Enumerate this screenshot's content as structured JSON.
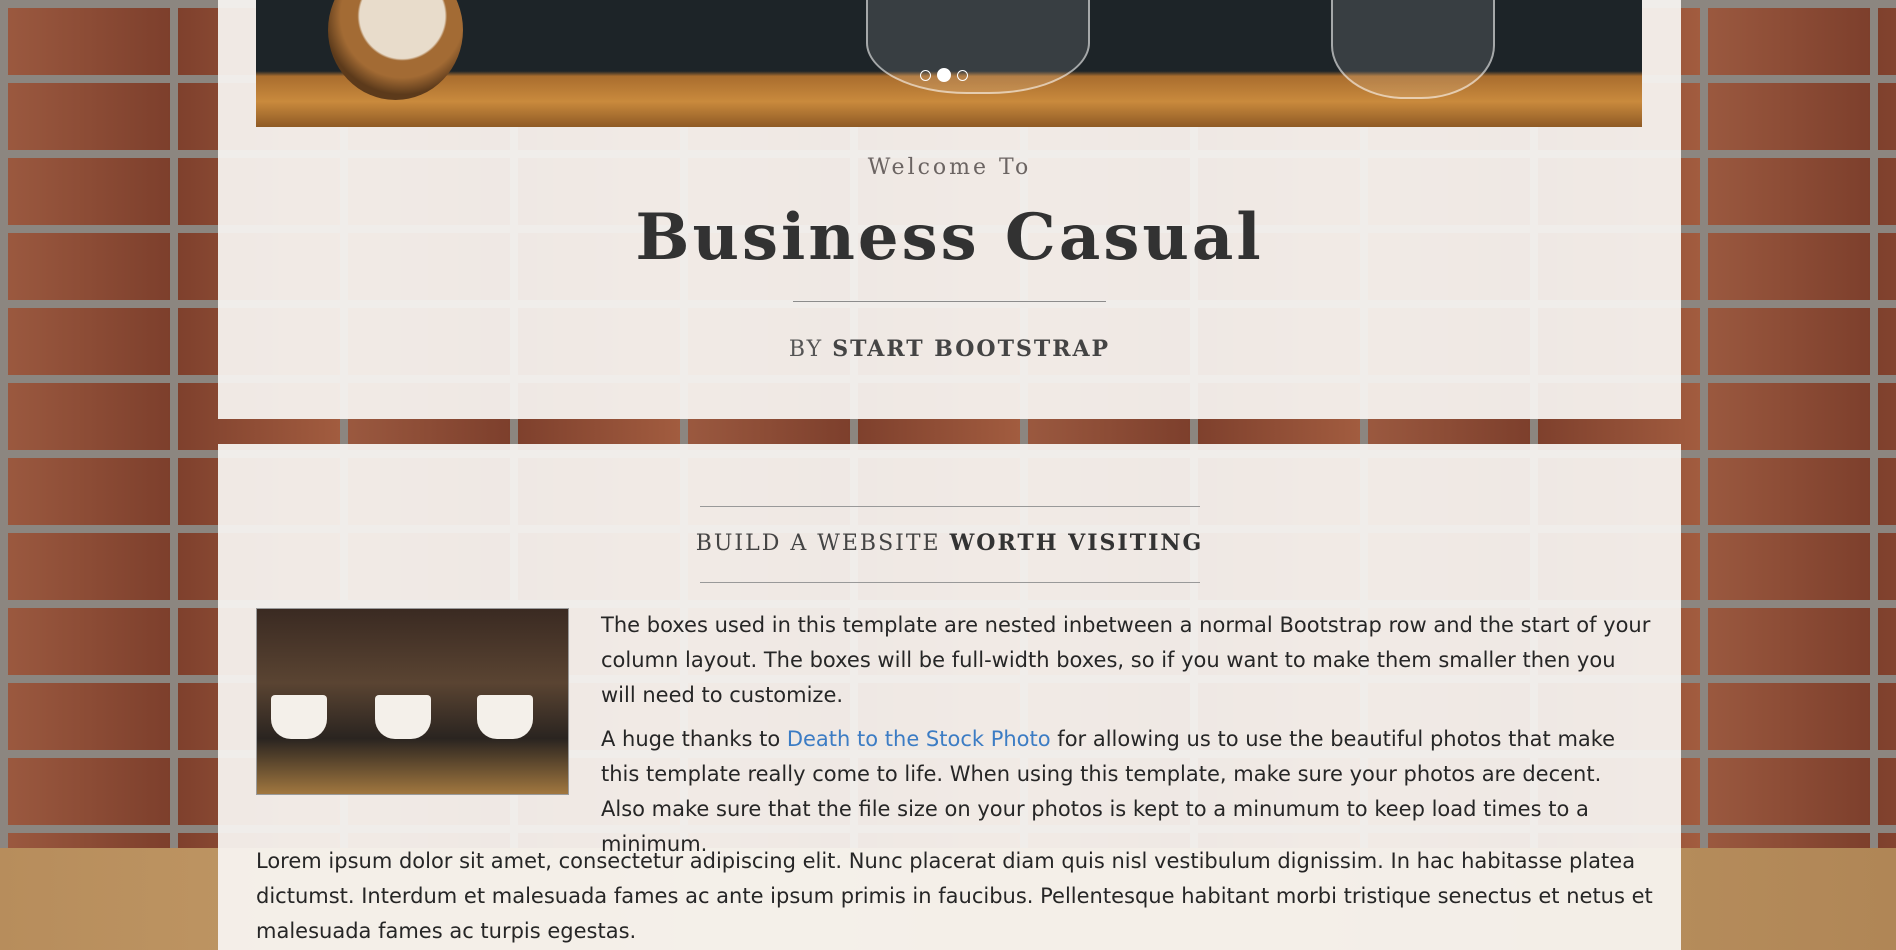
{
  "header": {
    "welcome": "Welcome To",
    "brand": "Business Casual",
    "byline_prefix": "BY",
    "byline_name": "START BOOTSTRAP"
  },
  "carousel": {
    "indicator_count": 3,
    "active_index": 1
  },
  "intro": {
    "heading_light": "BUILD A WEBSITE",
    "heading_bold": "WORTH VISITING",
    "paragraph1": "The boxes used in this template are nested inbetween a normal Bootstrap row and the start of your column layout. The boxes will be full-width boxes, so if you want to make them smaller then you will need to customize.",
    "paragraph2_before": "A huge thanks to ",
    "paragraph2_link": "Death to the Stock Photo",
    "paragraph2_after": " for allowing us to use the beautiful photos that make this template really come to life. When using this template, make sure your photos are decent. Also make sure that the file size on your photos is kept to a minumum to keep load times to a minimum.",
    "paragraph3": "Lorem ipsum dolor sit amet, consectetur adipiscing elit. Nunc placerat diam quis nisl vestibulum dignissim. In hac habitasse platea dictumst. Interdum et malesuada fames ac ante ipsum primis in faucibus. Pellentesque habitant morbi tristique senectus et netus et malesuada fames ac turpis egestas."
  },
  "colors": {
    "link": "#3c7cc4",
    "text": "#262626",
    "box": "#f8f5f2"
  }
}
